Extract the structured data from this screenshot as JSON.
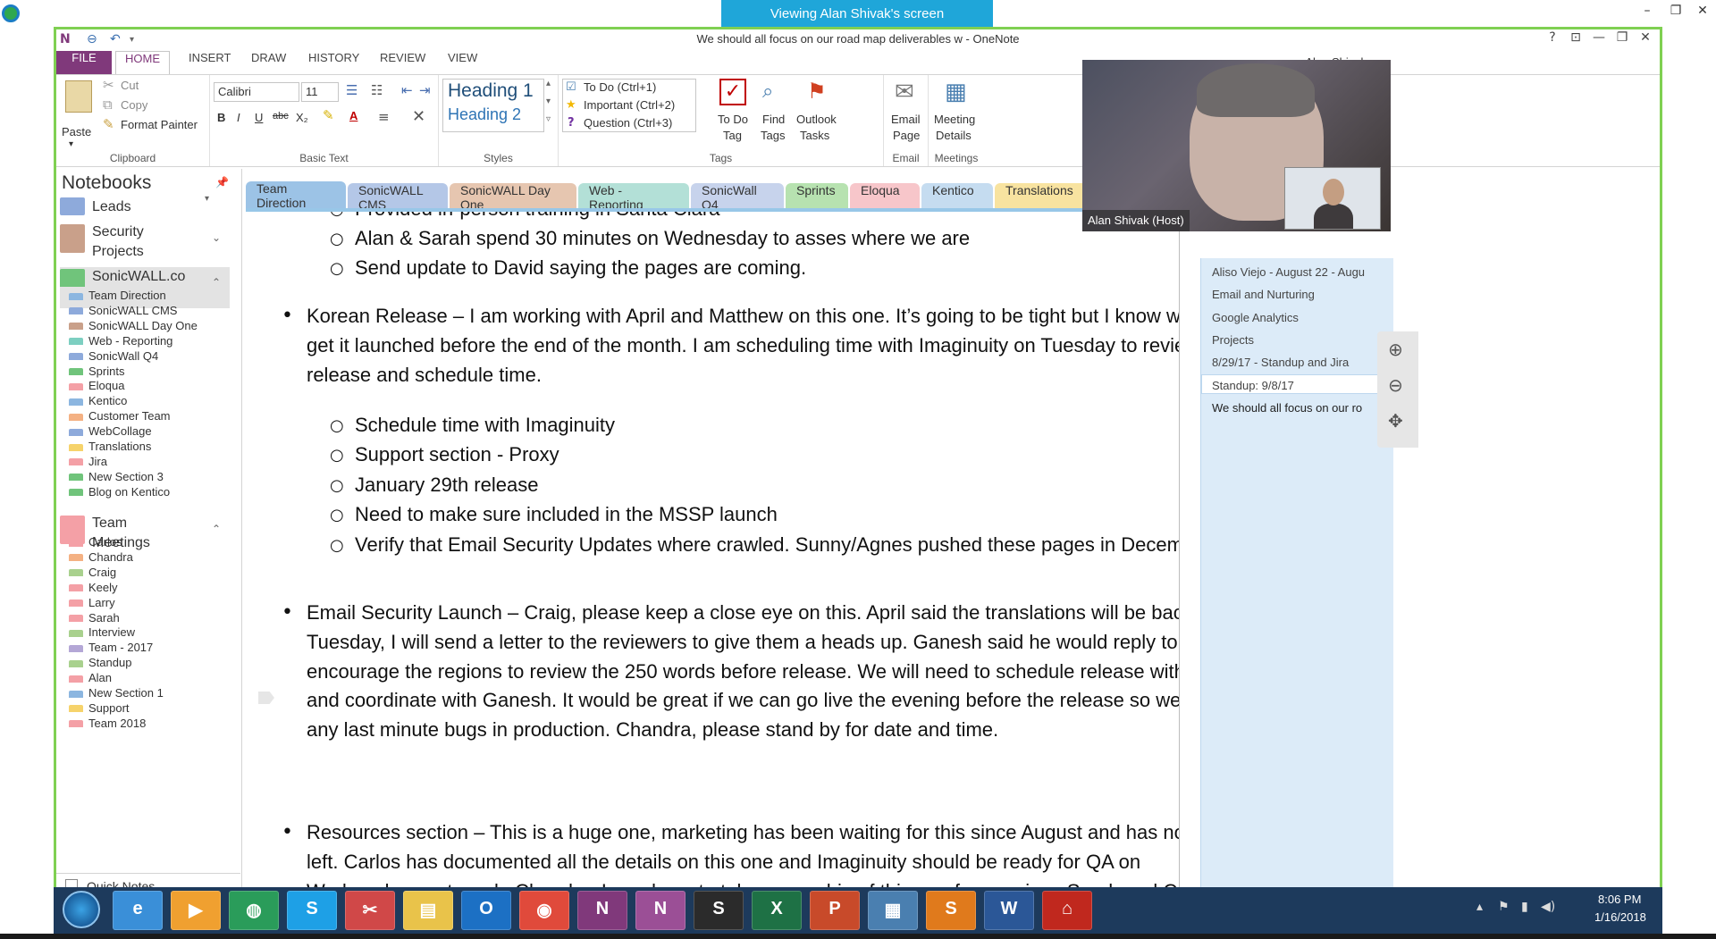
{
  "share": {
    "banner": "Viewing Alan Shivak's screen",
    "minimize": "–",
    "restore": "❐",
    "close": "✕"
  },
  "window": {
    "title": "We should all focus on our road map deliverables w  -  OneNote",
    "help": "?",
    "minimize": "—",
    "restore": "❐",
    "close": "✕"
  },
  "menu": {
    "file": "FILE",
    "home": "HOME",
    "insert": "INSERT",
    "draw": "DRAW",
    "history": "HISTORY",
    "review": "REVIEW",
    "view": "VIEW",
    "account": "Alan Shivak"
  },
  "ribbon": {
    "clipboard": {
      "paste": "Paste",
      "cut": "Cut",
      "copy": "Copy",
      "format_painter": "Format Painter",
      "label": "Clipboard"
    },
    "basic_text": {
      "font": "Calibri",
      "size": "11",
      "bold": "B",
      "italic": "I",
      "underline": "U",
      "strike": "abc",
      "subscript": "X₂",
      "font_color": "A",
      "label": "Basic Text"
    },
    "styles": {
      "heading1": "Heading 1",
      "heading2": "Heading 2",
      "label": "Styles"
    },
    "tags": {
      "todo": "To Do (Ctrl+1)",
      "important": "Important (Ctrl+2)",
      "question": "Question (Ctrl+3)",
      "todo_tag_1": "To Do",
      "todo_tag_2": "Tag",
      "find_tags_1": "Find",
      "find_tags_2": "Tags",
      "outlook_tasks_1": "Outlook",
      "outlook_tasks_2": "Tasks",
      "label": "Tags"
    },
    "email": {
      "line1": "Email",
      "line2": "Page",
      "label": "Email"
    },
    "meetings": {
      "line1": "Meeting",
      "line2": "Details",
      "label": "Meetings"
    }
  },
  "notebooks": {
    "header": "Notebooks",
    "books": [
      {
        "name": "Leads",
        "color": "#8eaadb"
      },
      {
        "name_1": "Security",
        "name_2": "Projects",
        "color": "#c9a08a"
      },
      {
        "name_1": "SonicWALL.co",
        "name_2": "m",
        "color": "#70c47b"
      },
      {
        "name_1": "Team",
        "name_2": "Meetings",
        "color": "#f4a0a6"
      }
    ],
    "sonicwall_sections": [
      {
        "name": "Team Direction",
        "color": "#8cb6e0"
      },
      {
        "name": "SonicWALL CMS",
        "color": "#8eaadb"
      },
      {
        "name": "SonicWALL Day One",
        "color": "#c9a08a"
      },
      {
        "name": "Web - Reporting",
        "color": "#7dcfc1"
      },
      {
        "name": "SonicWall Q4",
        "color": "#8eaadb"
      },
      {
        "name": "Sprints",
        "color": "#70c47b"
      },
      {
        "name": "Eloqua",
        "color": "#f4a0a6"
      },
      {
        "name": "Kentico",
        "color": "#8cb6e0"
      },
      {
        "name": "Customer Team",
        "color": "#f4b183"
      },
      {
        "name": "WebCollage",
        "color": "#8eaadb"
      },
      {
        "name": "Translations",
        "color": "#f6d36b"
      },
      {
        "name": "Jira",
        "color": "#f4a0a6"
      },
      {
        "name": "New Section 3",
        "color": "#70c47b"
      },
      {
        "name": "Blog on Kentico",
        "color": "#70c47b"
      }
    ],
    "team_sections": [
      {
        "name": "Carlos",
        "color": "#f4a0a6"
      },
      {
        "name": "Chandra",
        "color": "#f4b183"
      },
      {
        "name": "Craig",
        "color": "#a9d18e"
      },
      {
        "name": "Keely",
        "color": "#f4a0a6"
      },
      {
        "name": "Larry",
        "color": "#f4a0a6"
      },
      {
        "name": "Sarah",
        "color": "#f4a0a6"
      },
      {
        "name": "Interview",
        "color": "#a9d18e"
      },
      {
        "name": "Team - 2017",
        "color": "#b4a7d6"
      },
      {
        "name": "Standup",
        "color": "#a9d18e"
      },
      {
        "name": "Alan",
        "color": "#f4a0a6"
      },
      {
        "name": "New Section 1",
        "color": "#8cb6e0"
      },
      {
        "name": "Support",
        "color": "#f6d36b"
      },
      {
        "name": "Team 2018",
        "color": "#f4a0a6"
      }
    ],
    "quick_notes": "Quick Notes"
  },
  "section_tabs": [
    {
      "name": "Team Direction",
      "color": "#9cc3e6"
    },
    {
      "name": "SonicWALL CMS",
      "color": "#b4c7e7"
    },
    {
      "name": "SonicWALL Day One",
      "color": "#e6c6b0"
    },
    {
      "name": "Web - Reporting",
      "color": "#b3e0d7"
    },
    {
      "name": "SonicWall Q4",
      "color": "#c7d3ec"
    },
    {
      "name": "Sprints",
      "color": "#b7e2b0"
    },
    {
      "name": "Eloqua",
      "color": "#f7c6ca"
    },
    {
      "name": "Kentico",
      "color": "#c5dcf0"
    },
    {
      "name": "Translations",
      "color": "#f8e3a0"
    },
    {
      "name": "···",
      "color": "#e8e8e8"
    }
  ],
  "section_add": "+",
  "note": {
    "sub_a": [
      "Provided in-person training in Santa Clara",
      "Alan & Sarah spend 30 minutes on Wednesday to asses where we are",
      "Send update to David saying the pages are coming."
    ],
    "korean": [
      "Korean Release – I am working with April and Matthew on this one. It’s going to be tight but I know we can",
      "get it launched before the end of the month. I am scheduling time with Imaginuity on Tuesday to review the",
      "release and schedule time."
    ],
    "sub_b": [
      "Schedule time with Imaginuity",
      "Support section - Proxy",
      "January 29th release",
      "Need to make sure included in the MSSP launch",
      "Verify that Email Security Updates where crawled. Sunny/Agnes pushed these pages in December"
    ],
    "email": [
      "Email Security Launch – Craig, please keep a close eye on this. April said the translations will be back by",
      "Tuesday, I will send a letter to the reviewers to give them a heads up. Ganesh said he would reply to",
      "encourage the regions to review the 250 words before release. We will need to schedule release with April",
      "and coordinate with Ganesh. It would be great if we can go live the evening before the release so we can fix",
      "any last minute bugs in production. Chandra, please stand by for date and time."
    ],
    "resources": [
      "Resources section – This is a huge one, marketing has been waiting for this since August and has no patients",
      "left. Carlos has documented all the details on this one and Imaginuity should be ready for QA on",
      "Wednesday next week. Chandra, I need you to take ownership of this one for me since Sarah and Craig are"
    ]
  },
  "pages": [
    "Aliso Viejo - August 22 - Augu",
    "Email and Nurturing",
    "Google Analytics",
    "Projects",
    "8/29/17 - Standup and Jira",
    "Standup: 9/8/17",
    "We should all focus on our ro"
  ],
  "video": {
    "host_label": "Alan Shivak (Host)"
  },
  "taskbar": {
    "apps": [
      {
        "name": "ie",
        "glyph": "e",
        "color": "#3a8fd8"
      },
      {
        "name": "media",
        "glyph": "▶",
        "color": "#f0a030"
      },
      {
        "name": "globe",
        "glyph": "◍",
        "color": "#2a9c5a"
      },
      {
        "name": "skype",
        "glyph": "S",
        "color": "#1ea0e6"
      },
      {
        "name": "snip",
        "glyph": "✂",
        "color": "#d04848"
      },
      {
        "name": "explorer",
        "glyph": "▤",
        "color": "#e9c34a"
      },
      {
        "name": "outlook",
        "glyph": "O",
        "color": "#1c70c4"
      },
      {
        "name": "chrome",
        "glyph": "◉",
        "color": "#e04a3b"
      },
      {
        "name": "onenote",
        "glyph": "N",
        "color": "#80397b"
      },
      {
        "name": "onenote2",
        "glyph": "N",
        "color": "#9b4f96"
      },
      {
        "name": "app-s",
        "glyph": "S",
        "color": "#2b2b2b"
      },
      {
        "name": "excel",
        "glyph": "X",
        "color": "#1e7145"
      },
      {
        "name": "powerpoint",
        "glyph": "P",
        "color": "#c84a2a"
      },
      {
        "name": "photos",
        "glyph": "▦",
        "color": "#4a7fb0"
      },
      {
        "name": "app-s3",
        "glyph": "S",
        "color": "#e07a1c"
      },
      {
        "name": "word",
        "glyph": "W",
        "color": "#2b5797"
      },
      {
        "name": "pdf",
        "glyph": "⌂",
        "color": "#c0281e"
      }
    ],
    "time": "8:06 PM",
    "date": "1/16/2018"
  }
}
